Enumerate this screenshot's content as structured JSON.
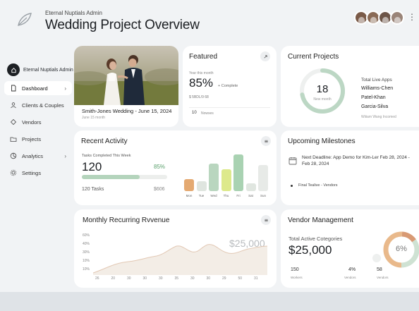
{
  "header": {
    "admin_label": "Eternal Nuptials Admin",
    "title": "Wedding Project Overview",
    "more": "⋮⋮",
    "avatar_colors": [
      "#7a5a48",
      "#8a6a55",
      "#6d5548",
      "#9a8478"
    ]
  },
  "sidebar": {
    "admin_label": "Eternal Nuptials Admin",
    "items": [
      {
        "label": "Dashboard",
        "icon": "file-icon",
        "chevron": "›",
        "active": true
      },
      {
        "label": "Clients & Couples",
        "icon": "people-icon"
      },
      {
        "label": "Vendors",
        "icon": "vendor-icon"
      },
      {
        "label": "Projects",
        "icon": "folder-icon"
      },
      {
        "label": "Analytics",
        "icon": "chart-icon",
        "chevron": "›"
      },
      {
        "label": "Settings",
        "icon": "gear-icon"
      }
    ]
  },
  "photo_card": {
    "caption": "Smith-Jones Wedding - June 15, 2024",
    "sub": "June 15 month"
  },
  "featured": {
    "title": "Featured",
    "small": "Year this month",
    "percent": "85%",
    "complete": "+ Complete",
    "line": "$ 5BDL/9 68",
    "count": "10",
    "count_label": "Nowses"
  },
  "current_projects": {
    "title": "Current Projects",
    "center_value": "18",
    "center_label": "New month",
    "progress": 0.72,
    "list_header": "Total Live Apps",
    "names": [
      "Williams-Chen",
      "Patel-Khan",
      "Garcia-Silva"
    ],
    "last": "Wiiiam Wang Incomed"
  },
  "recent_activity": {
    "title": "Recent Activity",
    "caption": "Tasks Completed This Week",
    "value": "120",
    "percent": "85%",
    "progress": 0.68,
    "tasks": "120 Tasks",
    "amount": "$606",
    "days": [
      "Mon",
      "Tue",
      "Wed",
      "Thu",
      "Fri",
      "Sat",
      "Sun"
    ],
    "bar_values": [
      0.32,
      0.27,
      0.75,
      0.6,
      1.0,
      0.22,
      0.72
    ],
    "bar_colors": [
      "#e4a971",
      "#dfe5df",
      "#b9d6bf",
      "#dde98c",
      "#a9d2b2",
      "#e0e6e0",
      "#e7eae7"
    ]
  },
  "milestones": {
    "title": "Upcoming Milestones",
    "deadline": "Next Deadline: App Demo for Kim-Ler Feb 28, 2024 -",
    "deadline_date": "Feb 28, 2024",
    "item": "Final Tealive - Vendors"
  },
  "revenue": {
    "title": "Monthly Recurring Rvvenue",
    "value": "$25,000",
    "y_ticks": [
      "60%",
      "40%",
      "30%",
      "10%",
      "10%"
    ],
    "x_ticks": [
      "26",
      "20",
      "30",
      "30",
      "30",
      "35",
      "30",
      "30",
      "29",
      "50",
      "31"
    ]
  },
  "vendor": {
    "title": "Vendor Management",
    "sub": "Total Active Cotegories",
    "value": "$25,000",
    "donut_percent": "6%",
    "stats": [
      {
        "value": "150",
        "label": "Workers"
      },
      {
        "value": "4%",
        "label": "Vendors"
      },
      {
        "value": "58",
        "label": "Vendors"
      }
    ]
  }
}
